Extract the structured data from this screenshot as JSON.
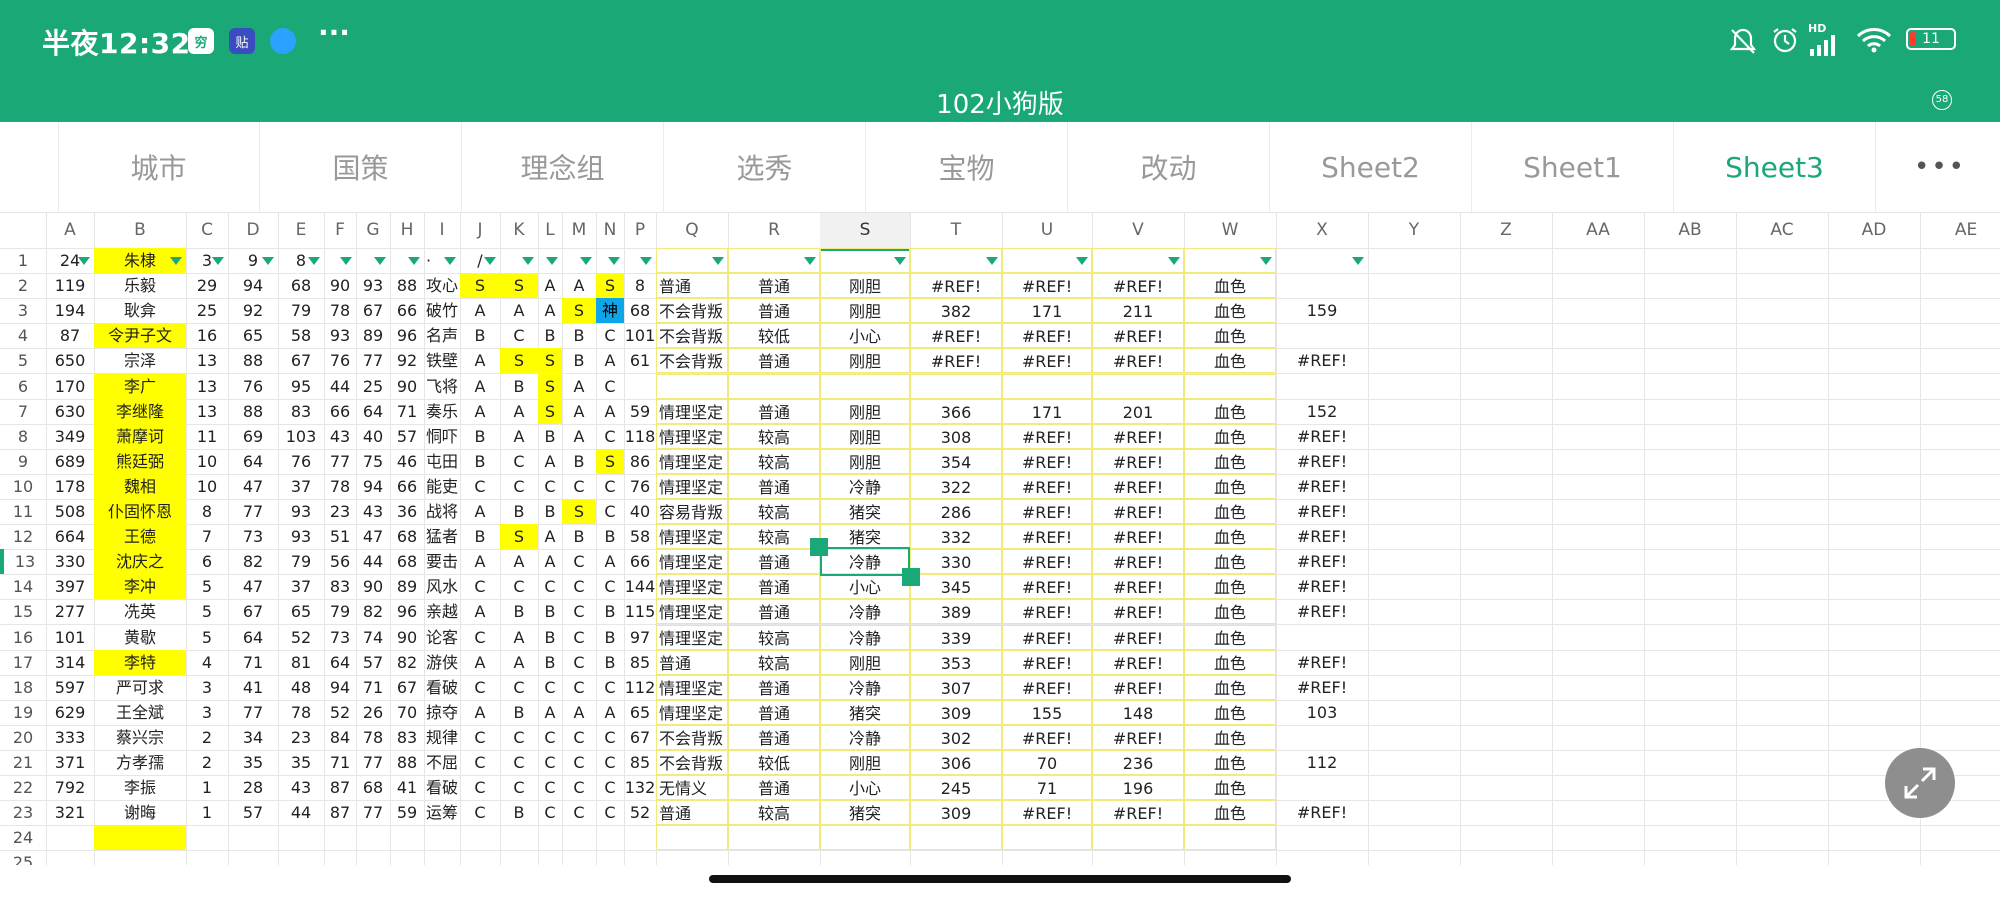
{
  "status_bar": {
    "time": "半夜12:32",
    "battery": "11",
    "signal_label": "HD",
    "more": "···",
    "app_icon_texts": [
      "穷",
      "贴",
      ""
    ]
  },
  "document": {
    "title": "102小狗版",
    "badge": "58"
  },
  "sheet_tabs": [
    {
      "label": "城市",
      "active": false
    },
    {
      "label": "国策",
      "active": false
    },
    {
      "label": "理念组",
      "active": false
    },
    {
      "label": "选秀",
      "active": false
    },
    {
      "label": "宝物",
      "active": false
    },
    {
      "label": "改动",
      "active": false
    },
    {
      "label": "Sheet2",
      "active": false
    },
    {
      "label": "Sheet1",
      "active": false
    },
    {
      "label": "Sheet3",
      "active": true
    }
  ],
  "more_tabs_label": "•••",
  "column_headers": [
    "A",
    "B",
    "C",
    "D",
    "E",
    "F",
    "G",
    "H",
    "I",
    "J",
    "K",
    "L",
    "M",
    "N",
    "P",
    "Q",
    "R",
    "S",
    "T",
    "U",
    "V",
    "W",
    "X",
    "Y",
    "Z",
    "AA",
    "AB",
    "AC",
    "AD",
    "AE"
  ],
  "selected_cell": "S13",
  "colors": {
    "brand": "#1ba877",
    "highlight_yellow": "#ffff00",
    "highlight_blue": "#0ea5e9",
    "cell_border": "#f2ea7a"
  },
  "rows": [
    {
      "n": "1",
      "A": "24",
      "B": "朱棣",
      "C": "3",
      "D": "9",
      "E": "8",
      "I": "·",
      "J": "/"
    },
    {
      "n": "2",
      "A": "119",
      "B": "乐毅",
      "C": "29",
      "D": "94",
      "E": "68",
      "F": "90",
      "G": "93",
      "H": "88",
      "I": "攻心",
      "J": "S",
      "K": "S",
      "L": "A",
      "M": "A",
      "N": "S",
      "P": "8",
      "Q": "普通",
      "R": "普通",
      "S": "刚胆",
      "T": "#REF!",
      "U": "#REF!",
      "V": "#REF!",
      "W": "血色",
      "X": ""
    },
    {
      "n": "3",
      "A": "194",
      "B": "耿弇",
      "C": "25",
      "D": "92",
      "E": "79",
      "F": "78",
      "G": "67",
      "H": "66",
      "I": "破竹",
      "J": "A",
      "K": "A",
      "L": "A",
      "M": "S",
      "N": "神",
      "P": "68",
      "Q": "不会背叛",
      "R": "普通",
      "S": "刚胆",
      "T": "382",
      "U": "171",
      "V": "211",
      "W": "血色",
      "X": "159"
    },
    {
      "n": "4",
      "A": "87",
      "B": "令尹子文",
      "C": "16",
      "D": "65",
      "E": "58",
      "F": "93",
      "G": "89",
      "H": "96",
      "I": "名声",
      "J": "B",
      "K": "C",
      "L": "B",
      "M": "B",
      "N": "C",
      "P": "101",
      "Q": "不会背叛",
      "R": "较低",
      "S": "小心",
      "T": "#REF!",
      "U": "#REF!",
      "V": "#REF!",
      "W": "血色",
      "X": ""
    },
    {
      "n": "5",
      "A": "650",
      "B": "宗泽",
      "C": "13",
      "D": "88",
      "E": "67",
      "F": "76",
      "G": "77",
      "H": "92",
      "I": "铁壁",
      "J": "A",
      "K": "S",
      "L": "S",
      "M": "B",
      "N": "A",
      "P": "61",
      "Q": "不会背叛",
      "R": "普通",
      "S": "刚胆",
      "T": "#REF!",
      "U": "#REF!",
      "V": "#REF!",
      "W": "血色",
      "X": "#REF!"
    },
    {
      "n": "6",
      "A": "170",
      "B": "李广",
      "C": "13",
      "D": "76",
      "E": "95",
      "F": "44",
      "G": "25",
      "H": "90",
      "I": "飞将",
      "J": "A",
      "K": "B",
      "L": "S",
      "M": "A",
      "N": "C",
      "P": "",
      "Q": "",
      "R": "",
      "S": "",
      "T": "",
      "U": "",
      "V": "",
      "W": "",
      "X": ""
    },
    {
      "n": "7",
      "A": "630",
      "B": "李继隆",
      "C": "13",
      "D": "88",
      "E": "83",
      "F": "66",
      "G": "64",
      "H": "71",
      "I": "奏乐",
      "J": "A",
      "K": "A",
      "L": "S",
      "M": "A",
      "N": "A",
      "P": "59",
      "Q": "情理坚定",
      "R": "普通",
      "S": "刚胆",
      "T": "366",
      "U": "171",
      "V": "201",
      "W": "血色",
      "X": "152"
    },
    {
      "n": "8",
      "A": "349",
      "B": "萧摩诃",
      "C": "11",
      "D": "69",
      "E": "103",
      "F": "43",
      "G": "40",
      "H": "57",
      "I": "恫吓",
      "J": "B",
      "K": "A",
      "L": "B",
      "M": "A",
      "N": "C",
      "P": "118",
      "Q": "情理坚定",
      "R": "较高",
      "S": "刚胆",
      "T": "308",
      "U": "#REF!",
      "V": "#REF!",
      "W": "血色",
      "X": "#REF!"
    },
    {
      "n": "9",
      "A": "689",
      "B": "熊廷弼",
      "C": "10",
      "D": "64",
      "E": "76",
      "F": "77",
      "G": "75",
      "H": "46",
      "I": "屯田",
      "J": "B",
      "K": "C",
      "L": "A",
      "M": "B",
      "N": "S",
      "P": "86",
      "Q": "情理坚定",
      "R": "较高",
      "S": "刚胆",
      "T": "354",
      "U": "#REF!",
      "V": "#REF!",
      "W": "血色",
      "X": "#REF!"
    },
    {
      "n": "10",
      "A": "178",
      "B": "魏相",
      "C": "10",
      "D": "47",
      "E": "37",
      "F": "78",
      "G": "94",
      "H": "66",
      "I": "能吏",
      "J": "C",
      "K": "C",
      "L": "C",
      "M": "C",
      "N": "C",
      "P": "76",
      "Q": "情理坚定",
      "R": "普通",
      "S": "冷静",
      "T": "322",
      "U": "#REF!",
      "V": "#REF!",
      "W": "血色",
      "X": "#REF!"
    },
    {
      "n": "11",
      "A": "508",
      "B": "仆固怀恩",
      "C": "8",
      "D": "77",
      "E": "93",
      "F": "23",
      "G": "43",
      "H": "36",
      "I": "战将",
      "J": "A",
      "K": "B",
      "L": "B",
      "M": "S",
      "N": "C",
      "P": "40",
      "Q": "容易背叛",
      "R": "较高",
      "S": "猪突",
      "T": "286",
      "U": "#REF!",
      "V": "#REF!",
      "W": "血色",
      "X": "#REF!"
    },
    {
      "n": "12",
      "A": "664",
      "B": "王德",
      "C": "7",
      "D": "73",
      "E": "93",
      "F": "51",
      "G": "47",
      "H": "68",
      "I": "猛者",
      "J": "B",
      "K": "S",
      "L": "A",
      "M": "B",
      "N": "B",
      "P": "58",
      "Q": "情理坚定",
      "R": "较高",
      "S": "猪突",
      "T": "332",
      "U": "#REF!",
      "V": "#REF!",
      "W": "血色",
      "X": "#REF!"
    },
    {
      "n": "13",
      "A": "330",
      "B": "沈庆之",
      "C": "6",
      "D": "82",
      "E": "79",
      "F": "56",
      "G": "44",
      "H": "68",
      "I": "要击",
      "J": "A",
      "K": "A",
      "L": "A",
      "M": "C",
      "N": "A",
      "P": "66",
      "Q": "情理坚定",
      "R": "普通",
      "S": "冷静",
      "T": "330",
      "U": "#REF!",
      "V": "#REF!",
      "W": "血色",
      "X": "#REF!"
    },
    {
      "n": "14",
      "A": "397",
      "B": "李冲",
      "C": "5",
      "D": "47",
      "E": "37",
      "F": "83",
      "G": "90",
      "H": "89",
      "I": "风水",
      "J": "C",
      "K": "C",
      "L": "C",
      "M": "C",
      "N": "C",
      "P": "144",
      "Q": "情理坚定",
      "R": "普通",
      "S": "小心",
      "T": "345",
      "U": "#REF!",
      "V": "#REF!",
      "W": "血色",
      "X": "#REF!"
    },
    {
      "n": "15",
      "A": "277",
      "B": "冼英",
      "C": "5",
      "D": "67",
      "E": "65",
      "F": "79",
      "G": "82",
      "H": "96",
      "I": "亲越",
      "J": "A",
      "K": "B",
      "L": "B",
      "M": "C",
      "N": "B",
      "P": "115",
      "Q": "情理坚定",
      "R": "普通",
      "S": "冷静",
      "T": "389",
      "U": "#REF!",
      "V": "#REF!",
      "W": "血色",
      "X": "#REF!"
    },
    {
      "n": "16",
      "A": "101",
      "B": "黄歇",
      "C": "5",
      "D": "64",
      "E": "52",
      "F": "73",
      "G": "74",
      "H": "90",
      "I": "论客",
      "J": "C",
      "K": "A",
      "L": "B",
      "M": "C",
      "N": "B",
      "P": "97",
      "Q": "情理坚定",
      "R": "较高",
      "S": "冷静",
      "T": "339",
      "U": "#REF!",
      "V": "#REF!",
      "W": "血色",
      "X": ""
    },
    {
      "n": "17",
      "A": "314",
      "B": "李特",
      "C": "4",
      "D": "71",
      "E": "81",
      "F": "64",
      "G": "57",
      "H": "82",
      "I": "游侠",
      "J": "A",
      "K": "A",
      "L": "B",
      "M": "C",
      "N": "B",
      "P": "85",
      "Q": "普通",
      "R": "较高",
      "S": "刚胆",
      "T": "353",
      "U": "#REF!",
      "V": "#REF!",
      "W": "血色",
      "X": "#REF!"
    },
    {
      "n": "18",
      "A": "597",
      "B": "严可求",
      "C": "3",
      "D": "41",
      "E": "48",
      "F": "94",
      "G": "71",
      "H": "67",
      "I": "看破",
      "J": "C",
      "K": "C",
      "L": "C",
      "M": "C",
      "N": "C",
      "P": "112",
      "Q": "情理坚定",
      "R": "普通",
      "S": "冷静",
      "T": "307",
      "U": "#REF!",
      "V": "#REF!",
      "W": "血色",
      "X": "#REF!"
    },
    {
      "n": "19",
      "A": "629",
      "B": "王全斌",
      "C": "3",
      "D": "77",
      "E": "78",
      "F": "52",
      "G": "26",
      "H": "70",
      "I": "掠夺",
      "J": "A",
      "K": "B",
      "L": "A",
      "M": "A",
      "N": "A",
      "P": "65",
      "Q": "情理坚定",
      "R": "普通",
      "S": "猪突",
      "T": "309",
      "U": "155",
      "V": "148",
      "W": "血色",
      "X": "103"
    },
    {
      "n": "20",
      "A": "333",
      "B": "蔡兴宗",
      "C": "2",
      "D": "34",
      "E": "23",
      "F": "84",
      "G": "78",
      "H": "83",
      "I": "规律",
      "J": "C",
      "K": "C",
      "L": "C",
      "M": "C",
      "N": "C",
      "P": "67",
      "Q": "不会背叛",
      "R": "普通",
      "S": "冷静",
      "T": "302",
      "U": "#REF!",
      "V": "#REF!",
      "W": "血色",
      "X": ""
    },
    {
      "n": "21",
      "A": "371",
      "B": "方孝孺",
      "C": "2",
      "D": "35",
      "E": "35",
      "F": "71",
      "G": "77",
      "H": "88",
      "I": "不屈",
      "J": "C",
      "K": "C",
      "L": "C",
      "M": "C",
      "N": "C",
      "P": "85",
      "Q": "不会背叛",
      "R": "较低",
      "S": "刚胆",
      "T": "306",
      "U": "70",
      "V": "236",
      "W": "血色",
      "X": "112"
    },
    {
      "n": "22",
      "A": "792",
      "B": "李振",
      "C": "1",
      "D": "28",
      "E": "43",
      "F": "87",
      "G": "68",
      "H": "41",
      "I": "看破",
      "J": "C",
      "K": "C",
      "L": "C",
      "M": "C",
      "N": "C",
      "P": "132",
      "Q": "无情义",
      "R": "普通",
      "S": "小心",
      "T": "245",
      "U": "71",
      "V": "196",
      "W": "血色",
      "X": ""
    },
    {
      "n": "23",
      "A": "321",
      "B": "谢晦",
      "C": "1",
      "D": "57",
      "E": "44",
      "F": "87",
      "G": "77",
      "H": "59",
      "I": "运筹",
      "J": "C",
      "K": "B",
      "L": "C",
      "M": "C",
      "N": "C",
      "P": "52",
      "Q": "普通",
      "R": "较高",
      "S": "猪突",
      "T": "309",
      "U": "#REF!",
      "V": "#REF!",
      "W": "血色",
      "X": "#REF!"
    },
    {
      "n": "24"
    },
    {
      "n": "25"
    }
  ]
}
